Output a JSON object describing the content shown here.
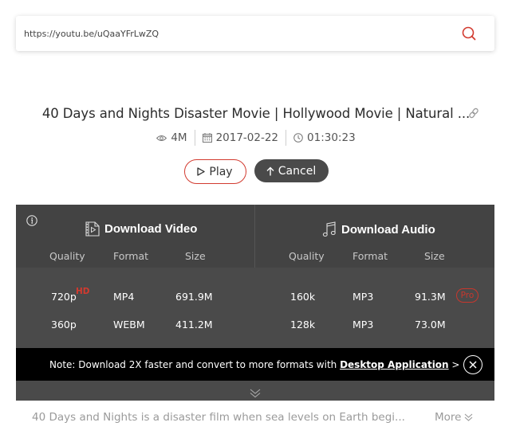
{
  "search": {
    "url_value": "https://youtu.be/uQaaYFrLwZQ",
    "search_icon": "search-icon"
  },
  "video": {
    "title": "40 Days and Nights Disaster Movie | Hollywood Movie | Natural ...",
    "views": "4M",
    "date": "2017-02-22",
    "duration": "01:30:23",
    "description": "40 Days and Nights is a disaster film when sea levels on Earth begi...",
    "more_label": "More"
  },
  "actions": {
    "play_label": "Play",
    "cancel_label": "Cancel"
  },
  "download_video": {
    "title": "Download Video",
    "columns": [
      "Quality",
      "Format",
      "Size"
    ],
    "rows": [
      {
        "quality": "720p",
        "badge": "HD",
        "format": "MP4",
        "size": "691.9M"
      },
      {
        "quality": "360p",
        "badge": "",
        "format": "WEBM",
        "size": "411.2M"
      }
    ]
  },
  "download_audio": {
    "title": "Download Audio",
    "columns": [
      "Quality",
      "Format",
      "Size"
    ],
    "rows": [
      {
        "quality": "160k",
        "format": "MP3",
        "size": "91.3M",
        "badge": "Pro"
      },
      {
        "quality": "128k",
        "format": "MP3",
        "size": "73.0M",
        "badge": ""
      }
    ]
  },
  "note": {
    "prefix": "Note: Download 2X faster and convert to more formats with ",
    "link_label": "Desktop Application",
    "suffix": " >"
  },
  "colors": {
    "accent_red": "#d23a2f",
    "panel_bg": "#4a4a4a",
    "panel_header_bg": "#434343",
    "note_bg": "#000000"
  }
}
